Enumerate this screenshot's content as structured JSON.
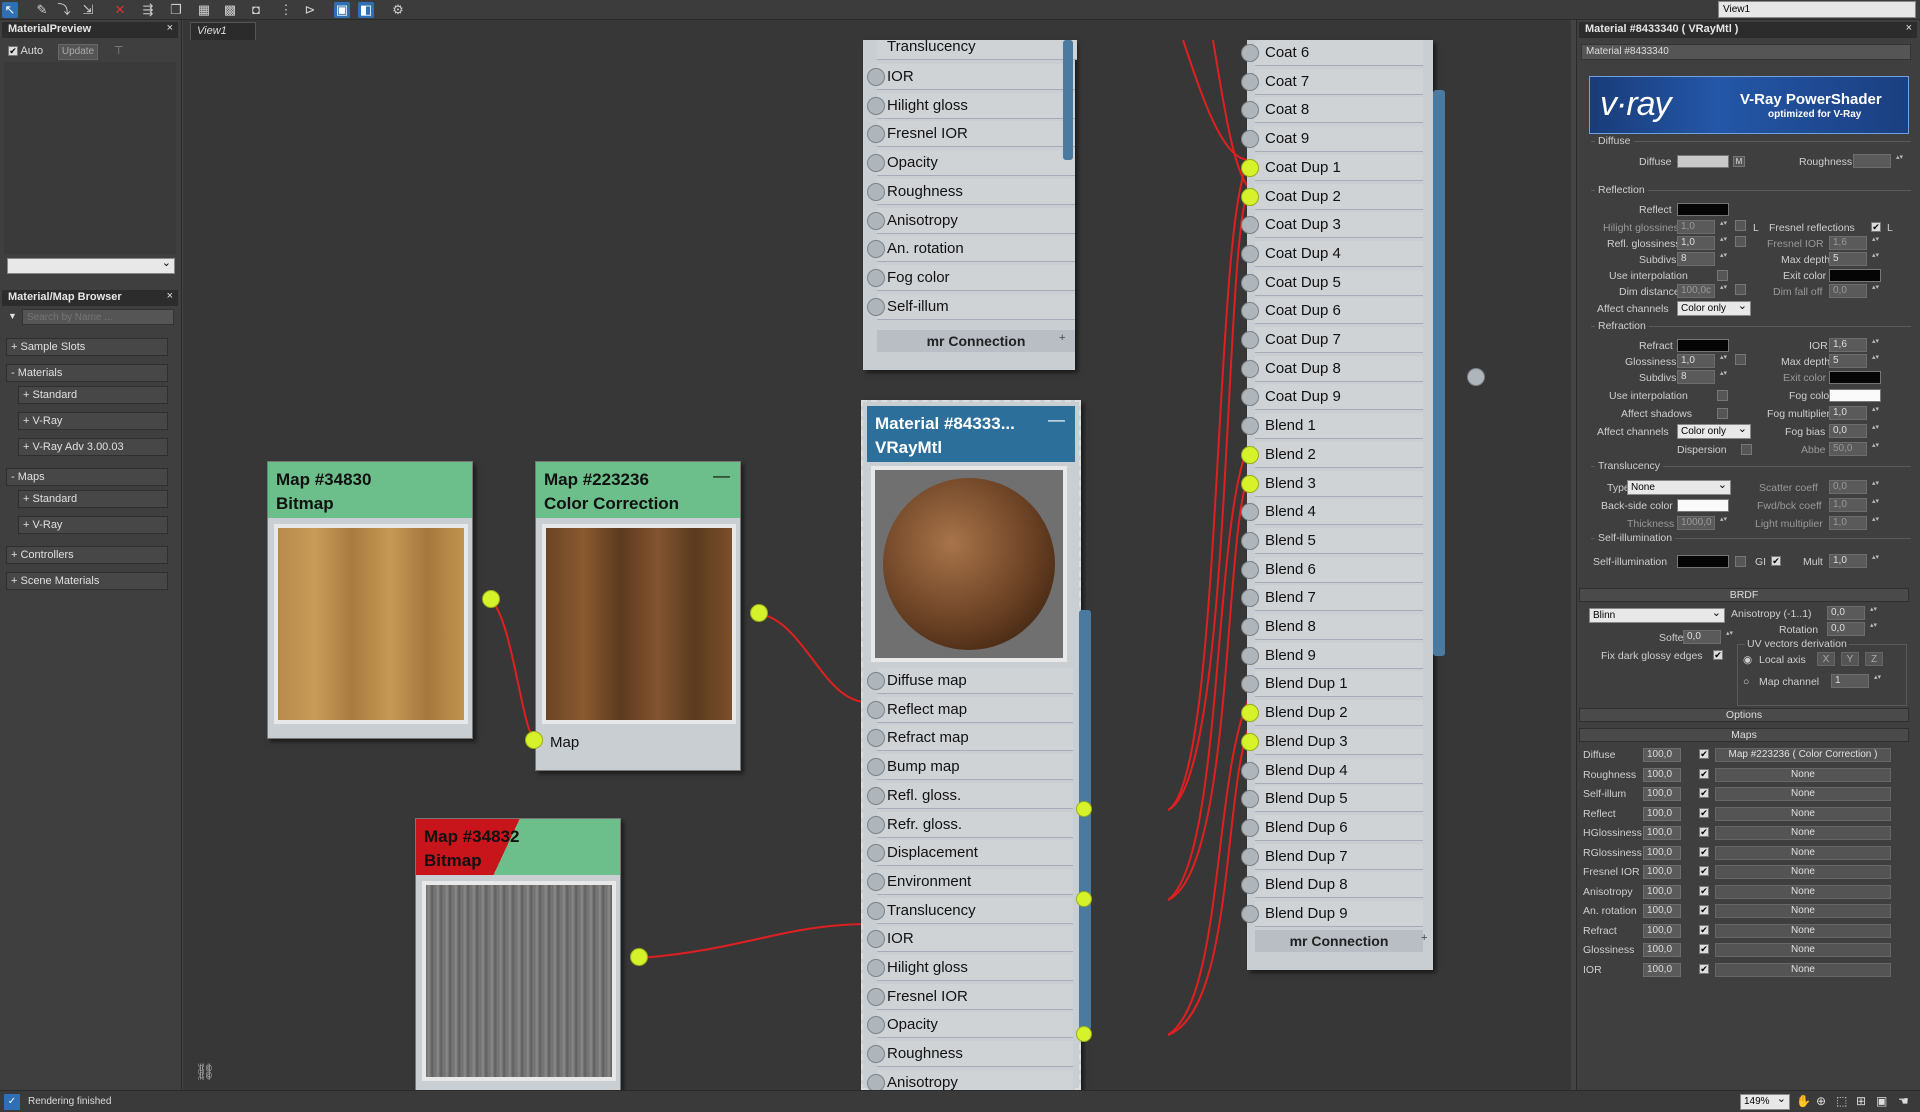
{
  "view_selector": "View1",
  "left_panel": {
    "preview_title": "MaterialPreview",
    "auto_label": "Auto",
    "update_label": "Update",
    "browser_title": "Material/Map Browser",
    "search_placeholder": "Search by Name ...",
    "tree": [
      "+ Sample Slots",
      "- Materials",
      "+ Standard",
      "+ V-Ray",
      "+ V-Ray Adv 3.00.03",
      "- Maps",
      "+ Standard",
      "+ V-Ray",
      "+ Controllers",
      "+ Scene Materials"
    ]
  },
  "view_tab": "View1",
  "nodes": {
    "map1": {
      "title": "Map #34830",
      "subtitle": "Bitmap"
    },
    "map2": {
      "title": "Map #223236",
      "subtitle": "Color Correction",
      "slot": "Map"
    },
    "map3": {
      "title": "Map #34832",
      "subtitle": "Bitmap"
    },
    "vray": {
      "title": "Material  #84333...",
      "subtitle": "VRayMtl",
      "slots": [
        "Diffuse map",
        "Reflect map",
        "Refract map",
        "Bump map",
        "Refl. gloss.",
        "Refr. gloss.",
        "Displacement",
        "Environment",
        "Translucency",
        "IOR",
        "Hilight gloss",
        "Fresnel IOR",
        "Opacity",
        "Roughness",
        "Anisotropy"
      ]
    },
    "top": {
      "partial": "Translucency",
      "slots": [
        "IOR",
        "Hilight gloss",
        "Fresnel IOR",
        "Opacity",
        "Roughness",
        "Anisotropy",
        "An. rotation",
        "Fog color",
        "Self-illum"
      ],
      "footer": "mr Connection"
    },
    "blend": {
      "slots": [
        "Coat 6",
        "Coat 7",
        "Coat 8",
        "Coat 9",
        "Coat Dup 1",
        "Coat Dup 2",
        "Coat Dup 3",
        "Coat Dup 4",
        "Coat Dup 5",
        "Coat Dup 6",
        "Coat Dup 7",
        "Coat Dup 8",
        "Coat Dup 9",
        "Blend 1",
        "Blend 2",
        "Blend 3",
        "Blend 4",
        "Blend 5",
        "Blend 6",
        "Blend 7",
        "Blend 8",
        "Blend 9",
        "Blend Dup 1",
        "Blend Dup 2",
        "Blend Dup 3",
        "Blend Dup 4",
        "Blend Dup 5",
        "Blend Dup 6",
        "Blend Dup 7",
        "Blend Dup 8",
        "Blend Dup 9"
      ],
      "active": [
        4,
        5,
        14,
        15,
        23,
        24
      ],
      "footer": "mr Connection"
    }
  },
  "right_panel": {
    "title": "Material #8433340  ( VRayMtl )",
    "name_field": "Material #8433340",
    "banner_logo": "v·ray",
    "banner_title": "V-Ray PowerShader",
    "banner_sub": "optimized for V-Ray",
    "diffuse": {
      "group": "Diffuse",
      "label": "Diffuse",
      "m": "M",
      "roughness_label": "Roughness",
      "roughness": "0,0"
    },
    "reflection": {
      "group": "Reflection",
      "reflect": "Reflect",
      "hilight": "Hilight glossiness",
      "hilight_v": "1,0",
      "l": "L",
      "fresnel": "Fresnel reflections",
      "refl_gloss": "Refl. glossiness",
      "refl_gloss_v": "1,0",
      "fresnel_ior": "Fresnel IOR",
      "fresnel_ior_v": "1,6",
      "subdivs": "Subdivs",
      "subdivs_v": "8",
      "max_depth": "Max depth",
      "max_depth_v": "5",
      "use_interp": "Use interpolation",
      "exit_color": "Exit color",
      "dim_dist": "Dim distance",
      "dim_dist_v": "100,0c",
      "dim_fall": "Dim fall off",
      "dim_fall_v": "0,0",
      "affect": "Affect channels",
      "affect_v": "Color only"
    },
    "refraction": {
      "group": "Refraction",
      "refract": "Refract",
      "ior": "IOR",
      "ior_v": "1,6",
      "gloss": "Glossiness",
      "gloss_v": "1,0",
      "max_depth": "Max depth",
      "max_depth_v": "5",
      "subdivs": "Subdivs",
      "subdivs_v": "8",
      "exit_color": "Exit color",
      "use_interp": "Use interpolation",
      "fog_color": "Fog color",
      "affect_shadows": "Affect shadows",
      "fog_mult": "Fog multiplier",
      "fog_mult_v": "1,0",
      "affect": "Affect channels",
      "affect_v": "Color only",
      "fog_bias": "Fog bias",
      "fog_bias_v": "0,0",
      "dispersion": "Dispersion",
      "abbe": "Abbe",
      "abbe_v": "50,0"
    },
    "translucency": {
      "group": "Translucency",
      "type": "Type",
      "type_v": "None",
      "scatter": "Scatter coeff",
      "scatter_v": "0,0",
      "backside": "Back-side color",
      "fwd": "Fwd/bck coeff",
      "fwd_v": "1,0",
      "thickness": "Thickness",
      "thickness_v": "1000,0",
      "light_mult": "Light multiplier",
      "light_mult_v": "1,0"
    },
    "selfillum": {
      "group": "Self-illumination",
      "label": "Self-illumination",
      "gi": "GI",
      "mult": "Mult",
      "mult_v": "1,0"
    },
    "brdf": {
      "bar": "BRDF",
      "type_v": "Blinn",
      "aniso": "Anisotropy (-1..1)",
      "aniso_v": "0,0",
      "rotation": "Rotation",
      "rotation_v": "0,0",
      "soften": "Soften",
      "soften_v": "0,0",
      "uv": "UV vectors derivation",
      "fix": "Fix dark glossy edges",
      "local": "Local axis",
      "x": "X",
      "y": "Y",
      "z": "Z",
      "mapch": "Map channel",
      "mapch_v": "1"
    },
    "options_bar": "Options",
    "maps_bar": "Maps",
    "maps": [
      {
        "label": "Diffuse",
        "amount": "100,0",
        "map": "Map #223236  ( Color Correction )"
      },
      {
        "label": "Roughness",
        "amount": "100,0",
        "map": "None"
      },
      {
        "label": "Self-illum",
        "amount": "100,0",
        "map": "None"
      },
      {
        "label": "Reflect",
        "amount": "100,0",
        "map": "None"
      },
      {
        "label": "HGlossiness",
        "amount": "100,0",
        "map": "None"
      },
      {
        "label": "RGlossiness",
        "amount": "100,0",
        "map": "None"
      },
      {
        "label": "Fresnel IOR",
        "amount": "100,0",
        "map": "None"
      },
      {
        "label": "Anisotropy",
        "amount": "100,0",
        "map": "None"
      },
      {
        "label": "An. rotation",
        "amount": "100,0",
        "map": "None"
      },
      {
        "label": "Refract",
        "amount": "100,0",
        "map": "None"
      },
      {
        "label": "Glossiness",
        "amount": "100,0",
        "map": "None"
      },
      {
        "label": "IOR",
        "amount": "100,0",
        "map": "None"
      }
    ]
  },
  "status": {
    "text": "Rendering finished",
    "zoom": "149%"
  }
}
